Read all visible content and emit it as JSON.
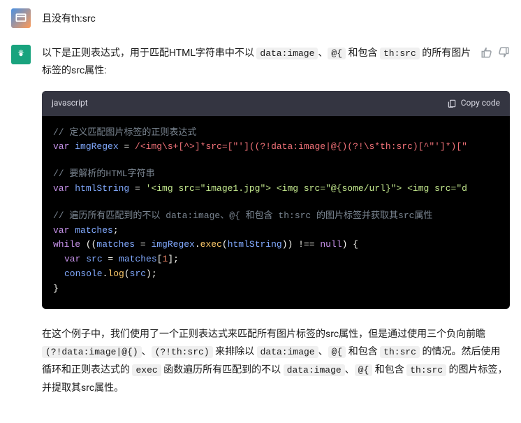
{
  "user": {
    "text": "且没有th:src"
  },
  "bot": {
    "intro_p1": "以下是正则表达式，用于匹配HTML字符串中不以 ",
    "intro_c1": "data:image",
    "intro_s1": "、",
    "intro_c2": "@{",
    "intro_s2": " 和包含 ",
    "intro_c3": "th:src",
    "intro_s3": " 的所有图片标签的src属性:"
  },
  "code": {
    "lang": "javascript",
    "copy": "Copy code",
    "cm1": "// 定义匹配图片标签的正则表达式",
    "kw_var": "var",
    "v_imgRegex": "imgRegex",
    "eq": " = ",
    "regex": "/<img\\s+[^>]*src=[\"']((?!data:image|@{)(?!\\s*th:src)[^\"']*)[\"",
    "cm2": "// 要解析的HTML字符串",
    "v_htmlString": "htmlString",
    "str_html": "'<img src=\"image1.jpg\"> <img src=\"@{some/url}\"> <img src=\"d",
    "cm3": "// 遍历所有匹配到的不以 data:image、@{ 和包含 th:src 的图片标签并获取其src属性",
    "v_matches": "matches",
    "semi": ";",
    "kw_while": "while",
    "open_paren": " ((",
    "assign": " = ",
    "dot": ".",
    "m_exec": "exec",
    "lp": "(",
    "rp": ")",
    "cmp": ") !== ",
    "null": "null",
    "close_cond": ") {",
    "v_src": "src",
    "bracket_open": "[",
    "idx": "1",
    "bracket_close": "]",
    "v_console": "console",
    "m_log": "log",
    "close_brace": "}"
  },
  "explain": {
    "p1": "在这个例子中，我们使用了一个正则表达式来匹配所有图片标签的src属性，但是通过使用三个负向前瞻 ",
    "c1": "(?!data:image|@{)",
    "s1": "、",
    "c2": "(?!th:src)",
    "s2": " 来排除以 ",
    "c3": "data:image",
    "s3": "、",
    "c4": "@{",
    "s4": " 和包含 ",
    "c5": "th:src",
    "s5": " 的情况。然后使用循环和正则表达式的 ",
    "c6": "exec",
    "s6": " 函数遍历所有匹配到的不以 ",
    "c7": "data:image",
    "s7": "、",
    "c8": "@{",
    "s8": " 和包含 ",
    "c9": "th:src",
    "s9": " 的图片标签，并提取其src属性。"
  }
}
